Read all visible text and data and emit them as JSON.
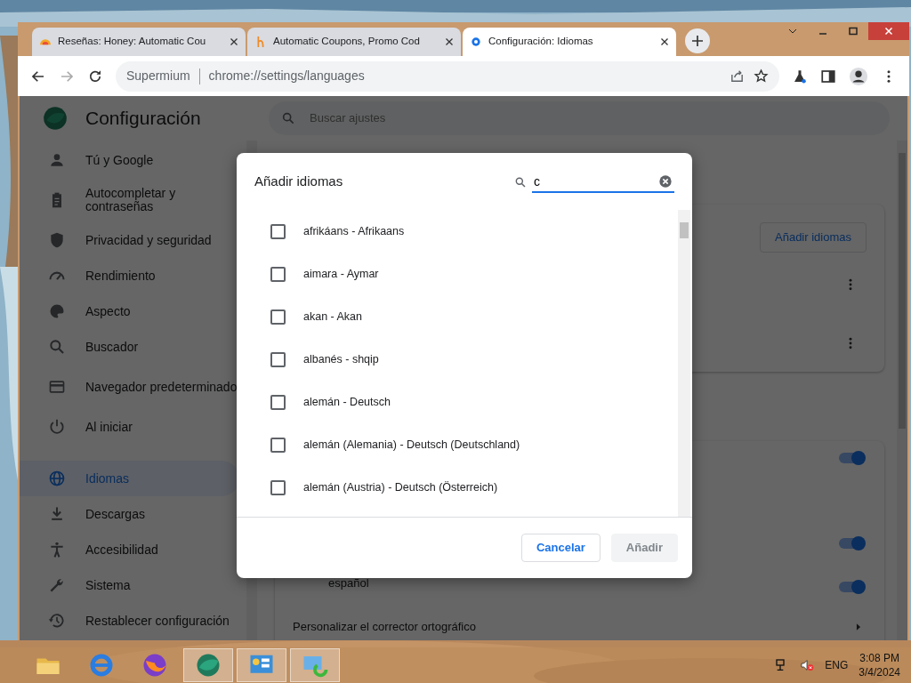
{
  "browser": {
    "tabs": [
      {
        "title": "Reseñas: Honey: Automatic Cou",
        "selected": false
      },
      {
        "title": "Automatic Coupons, Promo Cod",
        "selected": false
      },
      {
        "title": "Configuración: Idiomas",
        "selected": true
      }
    ],
    "address": {
      "site": "Supermium",
      "url": "chrome://settings/languages"
    }
  },
  "settings": {
    "title": "Configuración",
    "search_placeholder": "Buscar ajustes",
    "sidebar": [
      {
        "label": "Tú y Google",
        "selected": false
      },
      {
        "label": "Autocompletar y contraseñas",
        "selected": false
      },
      {
        "label": "Privacidad y seguridad",
        "selected": false
      },
      {
        "label": "Rendimiento",
        "selected": false
      },
      {
        "label": "Aspecto",
        "selected": false
      },
      {
        "label": "Buscador",
        "selected": false
      },
      {
        "label": "Navegador predeterminado",
        "selected": false
      },
      {
        "label": "Al iniciar",
        "selected": false
      },
      {
        "label": "Idiomas",
        "selected": true
      },
      {
        "label": "Descargas",
        "selected": false
      },
      {
        "label": "Accesibilidad",
        "selected": false
      },
      {
        "label": "Sistema",
        "selected": false
      },
      {
        "label": "Restablecer configuración",
        "selected": false
      }
    ],
    "add_button": "Añadir idiomas",
    "toggles": [
      {
        "on": true
      },
      {
        "on": true
      },
      {
        "on": true
      }
    ],
    "language_label": "español",
    "spellcheck_link": "Personalizar el corrector ortográfico"
  },
  "dialog": {
    "title": "Añadir idiomas",
    "search_value": "c",
    "languages": [
      {
        "label": "afrikáans - Afrikaans",
        "checked": false
      },
      {
        "label": "aimara - Aymar",
        "checked": false
      },
      {
        "label": "akan - Akan",
        "checked": false
      },
      {
        "label": "albanés - shqip",
        "checked": false
      },
      {
        "label": "alemán - Deutsch",
        "checked": false
      },
      {
        "label": "alemán (Alemania) - Deutsch (Deutschland)",
        "checked": false
      },
      {
        "label": "alemán (Austria) - Deutsch (Österreich)",
        "checked": false
      }
    ],
    "buttons": [
      {
        "label": "Cancelar",
        "kind": "secondary",
        "disabled": false
      },
      {
        "label": "Añadir",
        "kind": "primary",
        "disabled": true
      }
    ]
  },
  "taskbar": {
    "language": "ENG",
    "time": "3:08 PM",
    "date": "3/4/2024"
  }
}
